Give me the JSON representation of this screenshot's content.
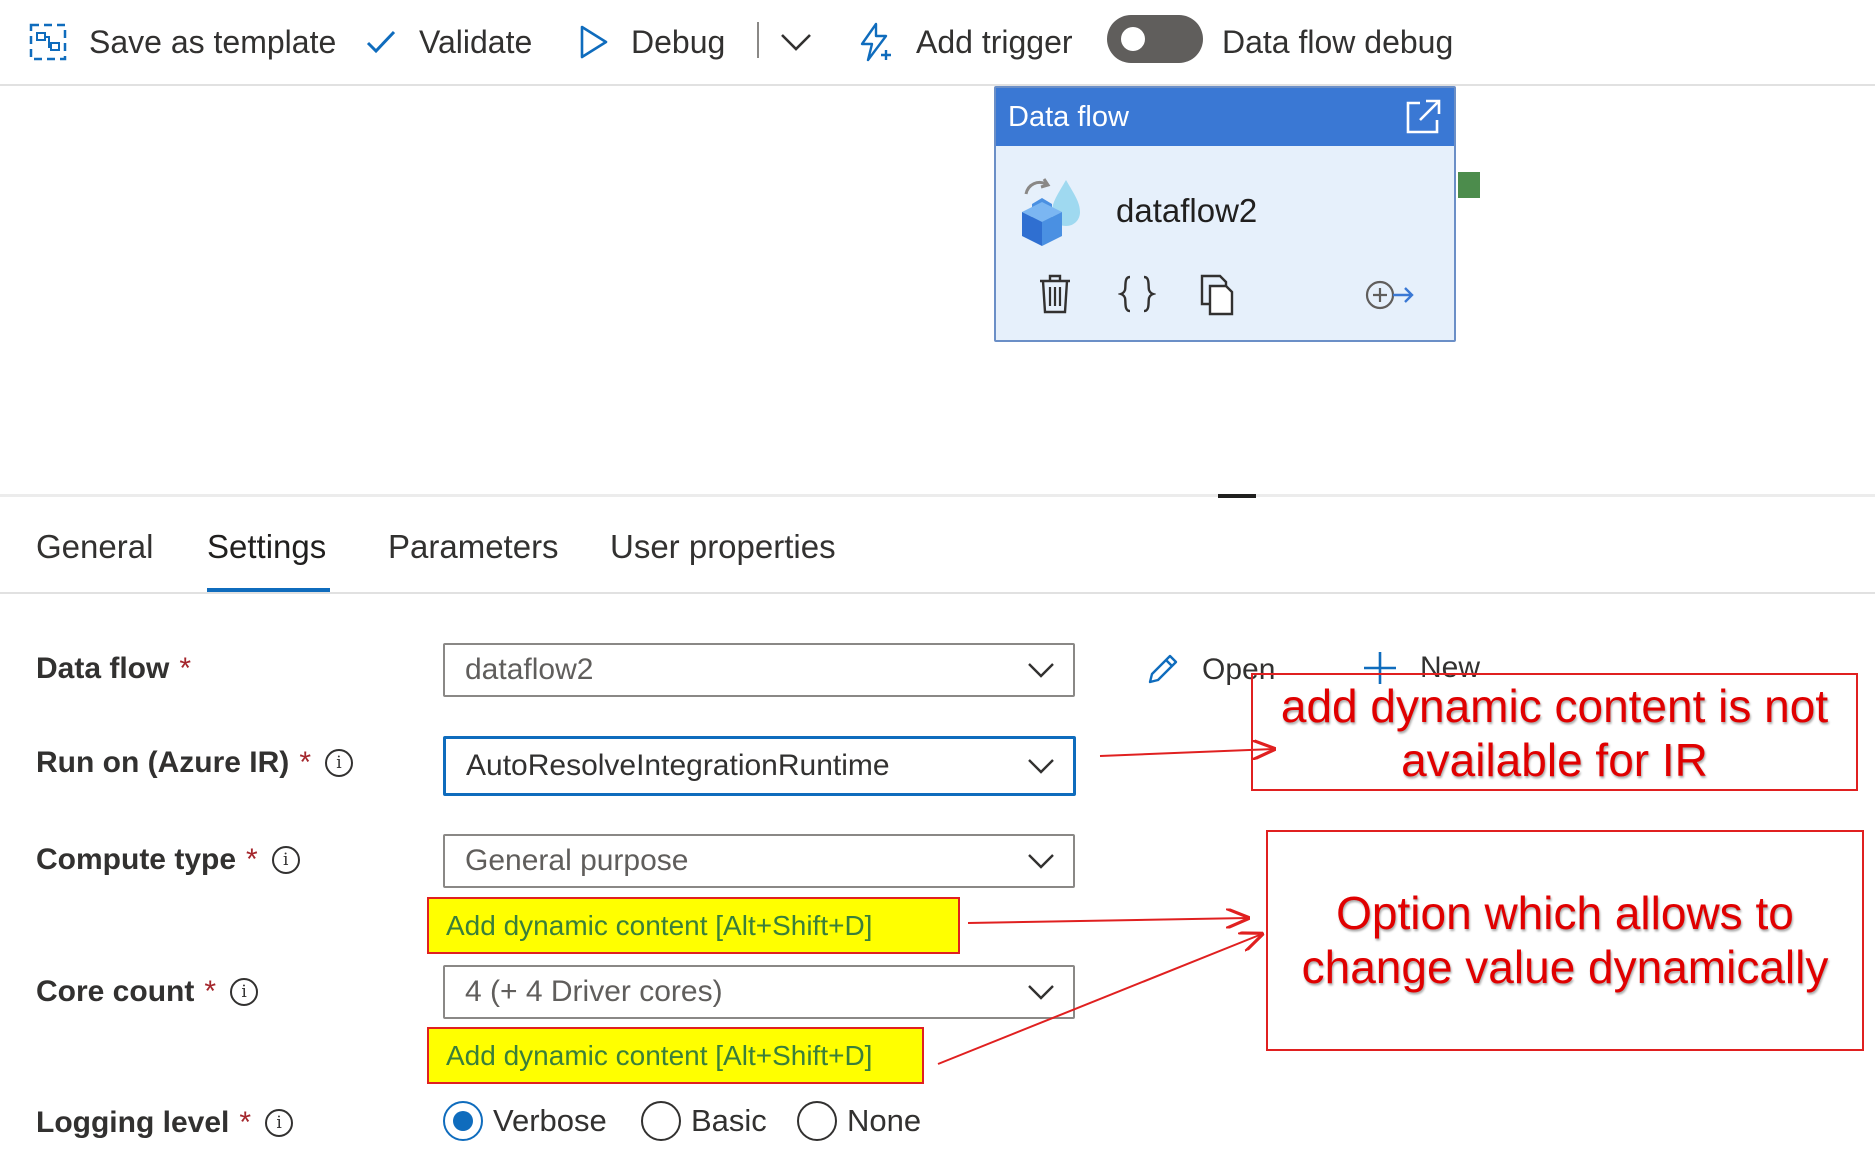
{
  "toolbar": {
    "save_as_template": "Save as template",
    "validate": "Validate",
    "debug": "Debug",
    "add_trigger": "Add trigger",
    "data_flow_debug": "Data flow debug",
    "data_flow_debug_on": false
  },
  "activity": {
    "header": "Data flow",
    "name": "dataflow2"
  },
  "tabs": [
    {
      "label": "General"
    },
    {
      "label": "Settings",
      "active": true
    },
    {
      "label": "Parameters"
    },
    {
      "label": "User properties"
    }
  ],
  "form": {
    "data_flow": {
      "label": "Data flow",
      "required": "*",
      "value": "dataflow2"
    },
    "open_label": "Open",
    "new_label": "New",
    "run_on": {
      "label": "Run on (Azure IR)",
      "required": "*",
      "value": "AutoResolveIntegrationRuntime"
    },
    "compute_type": {
      "label": "Compute type",
      "required": "*",
      "value": "General purpose",
      "dynamic": "Add dynamic content [Alt+Shift+D]"
    },
    "core_count": {
      "label": "Core count",
      "required": "*",
      "value": "4 (+ 4 Driver cores)",
      "dynamic": "Add dynamic content [Alt+Shift+D]"
    },
    "logging_level": {
      "label": "Logging level",
      "required": "*",
      "options": [
        "Verbose",
        "Basic",
        "None"
      ],
      "selected": "Verbose"
    }
  },
  "annotations": {
    "ir_note": "add dynamic content is not available for IR",
    "dynamic_note": "Option which allows to change value dynamically"
  },
  "colors": {
    "accent": "#0f6cbd",
    "card_header": "#3a78d4",
    "highlight": "#ffff00",
    "annotation": "#e00000"
  }
}
